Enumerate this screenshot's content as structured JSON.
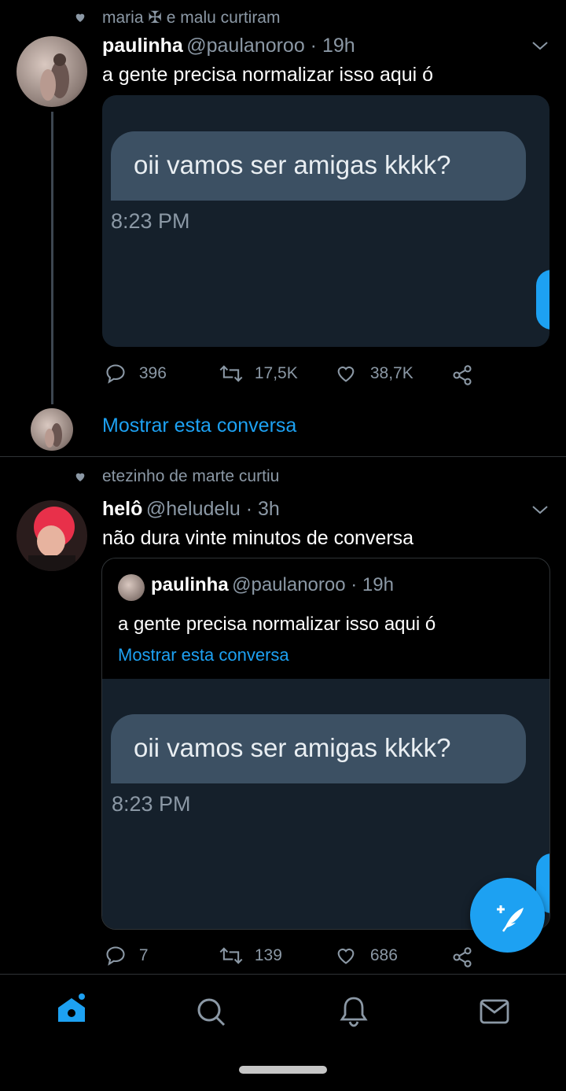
{
  "tweet1": {
    "social_context": "maria ✠ e malu curtiram",
    "name": "paulinha",
    "handle": "@paulanoroo · 19h",
    "text": "a gente precisa normalizar isso aqui ó",
    "media": {
      "bubble_text": "oii vamos ser amigas kkkk?",
      "timestamp": "8:23 PM"
    },
    "actions": {
      "replies": "396",
      "retweets": "17,5K",
      "likes": "38,7K"
    },
    "show_thread": "Mostrar esta conversa"
  },
  "tweet2": {
    "social_context": "etezinho de marte curtiu",
    "name": "helô",
    "handle": "@heludelu · 3h",
    "text": "não dura vinte minutos de conversa",
    "quote": {
      "name": "paulinha",
      "handle": "@paulanoroo · 19h",
      "text": "a gente precisa normalizar isso aqui ó",
      "show_thread": "Mostrar esta conversa"
    },
    "media": {
      "bubble_text": "oii vamos ser amigas kkkk?",
      "timestamp": "8:23 PM"
    },
    "actions": {
      "replies": "7",
      "retweets": "139",
      "likes": "686"
    }
  },
  "bottom_nav": {
    "items": [
      "home-icon",
      "search-icon",
      "notifications-icon",
      "messages-icon"
    ],
    "active": "home-icon"
  },
  "colors": {
    "accent": "#1da1f2",
    "background": "#000000",
    "muted": "#8b98a5",
    "bubble": "#3c5063",
    "media_bg": "#15202b"
  }
}
